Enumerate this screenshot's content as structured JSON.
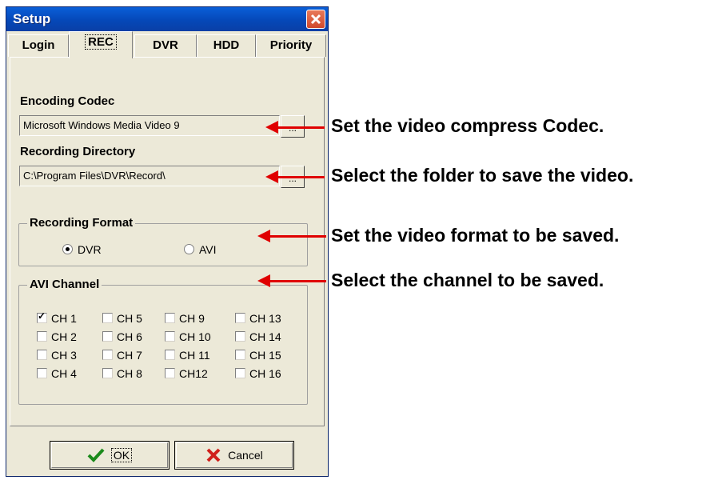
{
  "window": {
    "title": "Setup"
  },
  "tabs": [
    {
      "label": "Login",
      "active": false
    },
    {
      "label": "REC",
      "active": true
    },
    {
      "label": "DVR",
      "active": false
    },
    {
      "label": "HDD",
      "active": false
    },
    {
      "label": "Priority",
      "active": false
    }
  ],
  "encoding": {
    "label": "Encoding Codec",
    "value": "Microsoft Windows Media Video 9",
    "browse_label": "..."
  },
  "directory": {
    "label": "Recording Directory",
    "value": "C:\\Program Files\\DVR\\Record\\",
    "browse_label": "..."
  },
  "format": {
    "label": "Recording Format",
    "options": [
      {
        "label": "DVR",
        "selected": true
      },
      {
        "label": "AVI",
        "selected": false
      }
    ]
  },
  "channels": {
    "label": "AVI Channel",
    "items": [
      {
        "label": "CH 1",
        "checked": true
      },
      {
        "label": "CH 5",
        "checked": false
      },
      {
        "label": "CH 9",
        "checked": false
      },
      {
        "label": "CH 13",
        "checked": false
      },
      {
        "label": "CH 2",
        "checked": false
      },
      {
        "label": "CH 6",
        "checked": false
      },
      {
        "label": "CH 10",
        "checked": false
      },
      {
        "label": "CH 14",
        "checked": false
      },
      {
        "label": "CH 3",
        "checked": false
      },
      {
        "label": "CH 7",
        "checked": false
      },
      {
        "label": "CH 11",
        "checked": false
      },
      {
        "label": "CH 15",
        "checked": false
      },
      {
        "label": "CH 4",
        "checked": false
      },
      {
        "label": "CH 8",
        "checked": false
      },
      {
        "label": "CH12",
        "checked": false
      },
      {
        "label": "CH 16",
        "checked": false
      }
    ]
  },
  "buttons": {
    "ok": "OK",
    "cancel": "Cancel"
  },
  "annotations": {
    "codec": "Set the video compress Codec.",
    "folder": "Select the folder to save the video.",
    "format": "Set the video format to be saved.",
    "channel": "Select the channel to be saved."
  },
  "colors": {
    "arrow": "#e00000",
    "titlebar": "#0548b8",
    "dialog_bg": "#ece9d8"
  }
}
